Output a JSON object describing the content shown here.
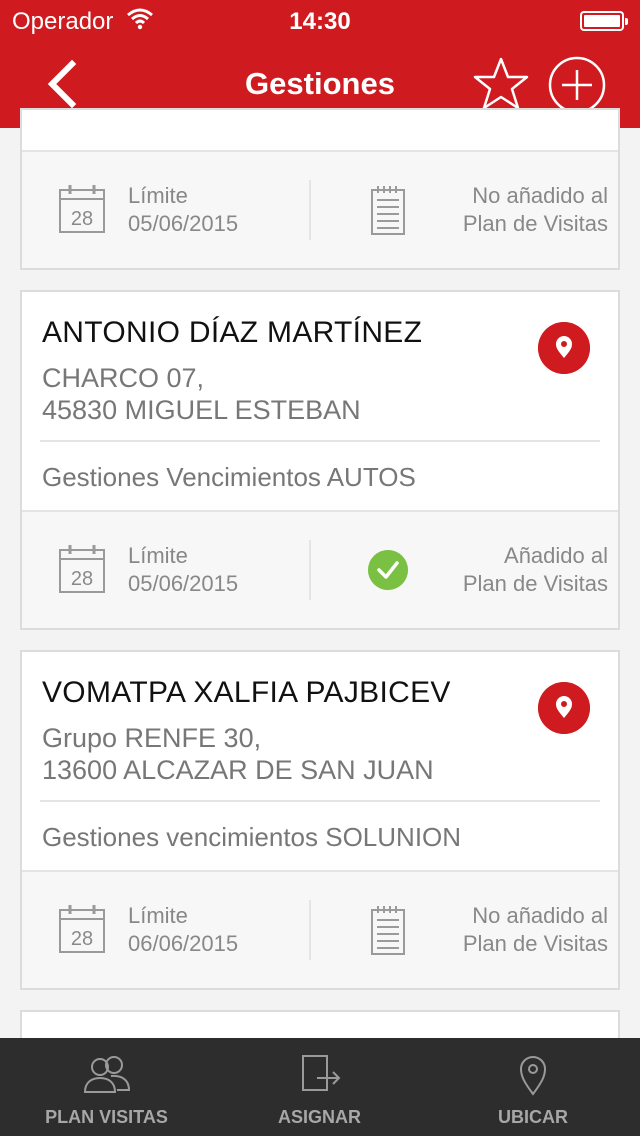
{
  "status_bar": {
    "carrier": "Operador",
    "time": "14:30"
  },
  "nav": {
    "title": "Gestiones",
    "icons": [
      "back-icon",
      "star-icon",
      "add-icon"
    ]
  },
  "cards": [
    {
      "limit_label": "Límite",
      "limit_date": "05/06/2015",
      "plan_line1": "No añadido al",
      "plan_line2": "Plan de Visitas",
      "in_plan": false
    },
    {
      "name": "ANTONIO DÍAZ MARTÍNEZ",
      "address_line1": "CHARCO 07,",
      "address_line2": "45830 MIGUEL ESTEBAN",
      "description": "Gestiones Vencimientos AUTOS",
      "limit_label": "Límite",
      "limit_date": "05/06/2015",
      "plan_line1": "Añadido al",
      "plan_line2": "Plan de Visitas",
      "in_plan": true
    },
    {
      "name": "VOMATPA XALFIA PAJBICEV",
      "address_line1": "Grupo RENFE 30,",
      "address_line2": "13600 ALCAZAR DE SAN JUAN",
      "description": "Gestiones vencimientos SOLUNION",
      "limit_label": "Límite",
      "limit_date": "06/06/2015",
      "plan_line1": "No añadido al",
      "plan_line2": "Plan de Visitas",
      "in_plan": false
    }
  ],
  "calendar_day": "28",
  "tabbar": {
    "items": [
      {
        "label": "PLAN VISITAS",
        "icon": "users-icon"
      },
      {
        "label": "ASIGNAR",
        "icon": "assign-icon"
      },
      {
        "label": "UBICAR",
        "icon": "location-icon"
      }
    ]
  },
  "colors": {
    "brand_red": "#cf1b1f",
    "check_green": "#7ac143",
    "tabbar_bg": "#2d2d2d"
  }
}
